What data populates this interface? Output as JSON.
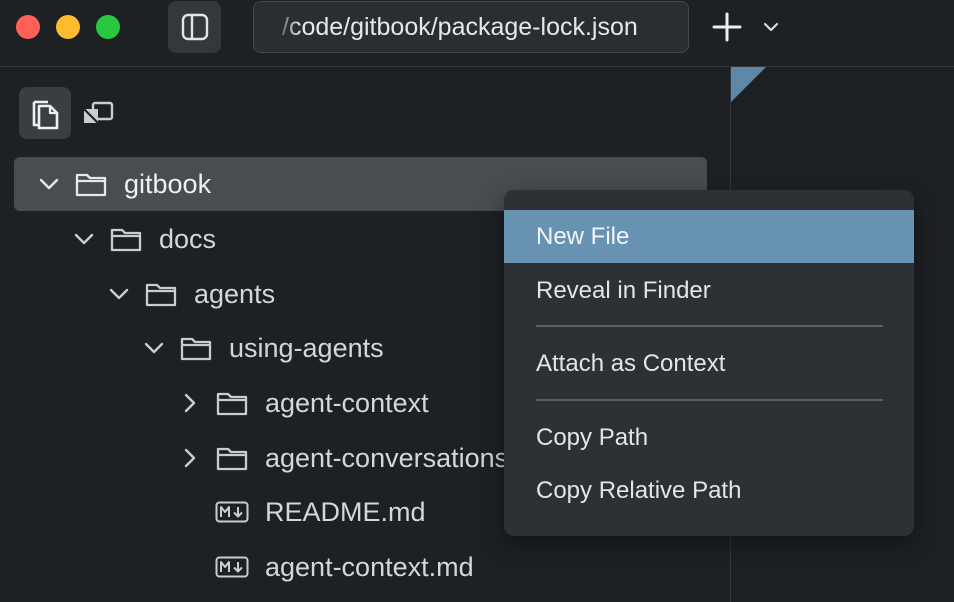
{
  "window": {
    "tab_title": "/code/gitbook/package-lock.json"
  },
  "toolbar": {
    "new_tab_icon": "plus-icon",
    "tab_menu_icon": "chevron-down-icon",
    "sidebar_toggle_icon": "sidebar-icon"
  },
  "sidebar": {
    "view_buttons": [
      {
        "icon": "files-icon",
        "selected": true
      },
      {
        "icon": "layers-icon",
        "selected": false
      }
    ],
    "tree": [
      {
        "label": "gitbook",
        "type": "folder",
        "expanded": true,
        "selected": true
      },
      {
        "label": "docs",
        "type": "folder",
        "expanded": true
      },
      {
        "label": "agents",
        "type": "folder",
        "expanded": true
      },
      {
        "label": "using-agents",
        "type": "folder",
        "expanded": true
      },
      {
        "label": "agent-context",
        "type": "folder",
        "expanded": false
      },
      {
        "label": "agent-conversations",
        "type": "folder",
        "expanded": false
      },
      {
        "label": "README.md",
        "type": "markdown"
      },
      {
        "label": "agent-context.md",
        "type": "markdown"
      }
    ]
  },
  "context_menu": {
    "items": [
      {
        "label": "New File",
        "highlighted": true
      },
      {
        "label": "Reveal in Finder"
      },
      {
        "label": "Attach as Context"
      },
      {
        "label": "Copy Path"
      },
      {
        "label": "Copy Relative Path"
      }
    ]
  },
  "colors": {
    "background": "#1e2124",
    "selection": "#494d52",
    "menu_background": "#2d3034",
    "menu_highlight": "#6792b2",
    "accent": "#5f87a8"
  }
}
